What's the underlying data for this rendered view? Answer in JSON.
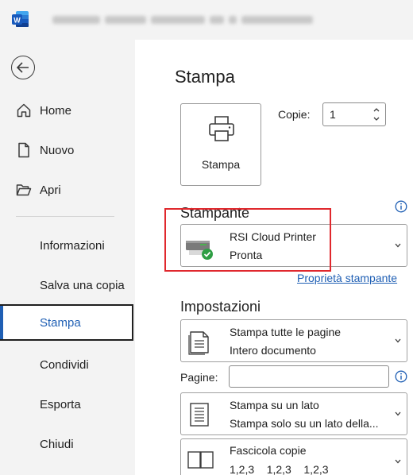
{
  "titlebar": {
    "app_icon": "word-logo-icon",
    "document_title_redacted": true
  },
  "sidebar": {
    "back_icon": "back-arrow-icon",
    "items": [
      {
        "label": "Home",
        "icon": "home-icon"
      },
      {
        "label": "Nuovo",
        "icon": "new-document-icon"
      },
      {
        "label": "Apri",
        "icon": "open-folder-icon"
      },
      {
        "label": "Informazioni"
      },
      {
        "label": "Salva una copia"
      },
      {
        "label": "Stampa",
        "selected": true
      },
      {
        "label": "Condividi"
      },
      {
        "label": "Esporta"
      },
      {
        "label": "Chiudi"
      }
    ]
  },
  "main": {
    "title": "Stampa",
    "print_button_label": "Stampa",
    "copies_label": "Copie:",
    "copies_value": "1",
    "printer_section": "Stampante",
    "printer": {
      "name": "RSI Cloud Printer",
      "status": "Pronta"
    },
    "printer_properties_link": "Proprietà stampante",
    "settings_section": "Impostazioni",
    "settings": [
      {
        "line1": "Stampa tutte le pagine",
        "line2": "Intero documento",
        "icon": "pages-document-icon"
      },
      {
        "line1": "Stampa su un lato",
        "line2": "Stampa solo su un lato della...",
        "icon": "one-sided-print-icon"
      },
      {
        "line1": "Fascicola copie",
        "line2": "1,2,3    1,2,3    1,2,3",
        "icon": "collate-icon"
      }
    ],
    "pages_label": "Pagine:",
    "pages_value": ""
  },
  "colors": {
    "accent": "#1f5fb4",
    "highlight_border": "#e0282d",
    "sidebar_bg": "#f3f3f3"
  }
}
